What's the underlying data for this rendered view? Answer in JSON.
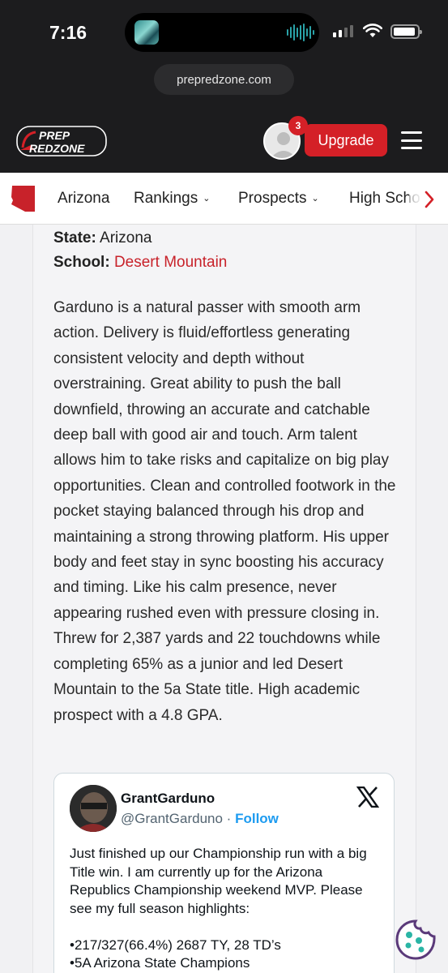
{
  "status_bar": {
    "time": "7:16"
  },
  "browser": {
    "url": "prepredzone.com"
  },
  "header": {
    "logo_text_top": "PREP",
    "logo_text_bottom": "REDZONE",
    "notification_count": "3",
    "upgrade_label": "Upgrade",
    "brand_color": "#d42027"
  },
  "nav": {
    "items": [
      {
        "label": "Arizona"
      },
      {
        "label": "Rankings"
      },
      {
        "label": "Prospects"
      },
      {
        "label": "High Scho"
      }
    ]
  },
  "article": {
    "state_label": "State:",
    "state_value": "Arizona",
    "school_label": "School:",
    "school_value": "Desert Mountain",
    "body": "Garduno is a natural passer with smooth arm action. Delivery is fluid/effortless generating consistent velocity and depth without overstraining. Great ability to push the ball downfield, throwing an accurate and catchable deep ball with good air and touch. Arm talent allows him to take risks and capitalize on big play opportunities. Clean and controlled footwork in the pocket staying balanced through his drop and maintaining a strong throwing platform. His upper body and feet stay in sync boosting his accuracy and timing. Like his calm presence, never appearing rushed even with pressure closing in. Threw for 2,387 yards and 22 touchdowns while completing 65% as a junior and led Desert Mountain to the 5a State title. High academic prospect with a 4.8 GPA."
  },
  "tweet": {
    "display_name": "GrantGarduno",
    "handle": "@GrantGarduno",
    "separator": "·",
    "follow_label": "Follow",
    "text_paragraph": "Just finished up our Championship run with a big Title win. I am currently up for the Arizona Republics Championship weekend MVP. Please see my full season highlights:",
    "stat_line_1": "•217/327(66.4%) 2687 TY, 28 TD’s",
    "stat_line_2": "•5A Arizona State Champions"
  }
}
